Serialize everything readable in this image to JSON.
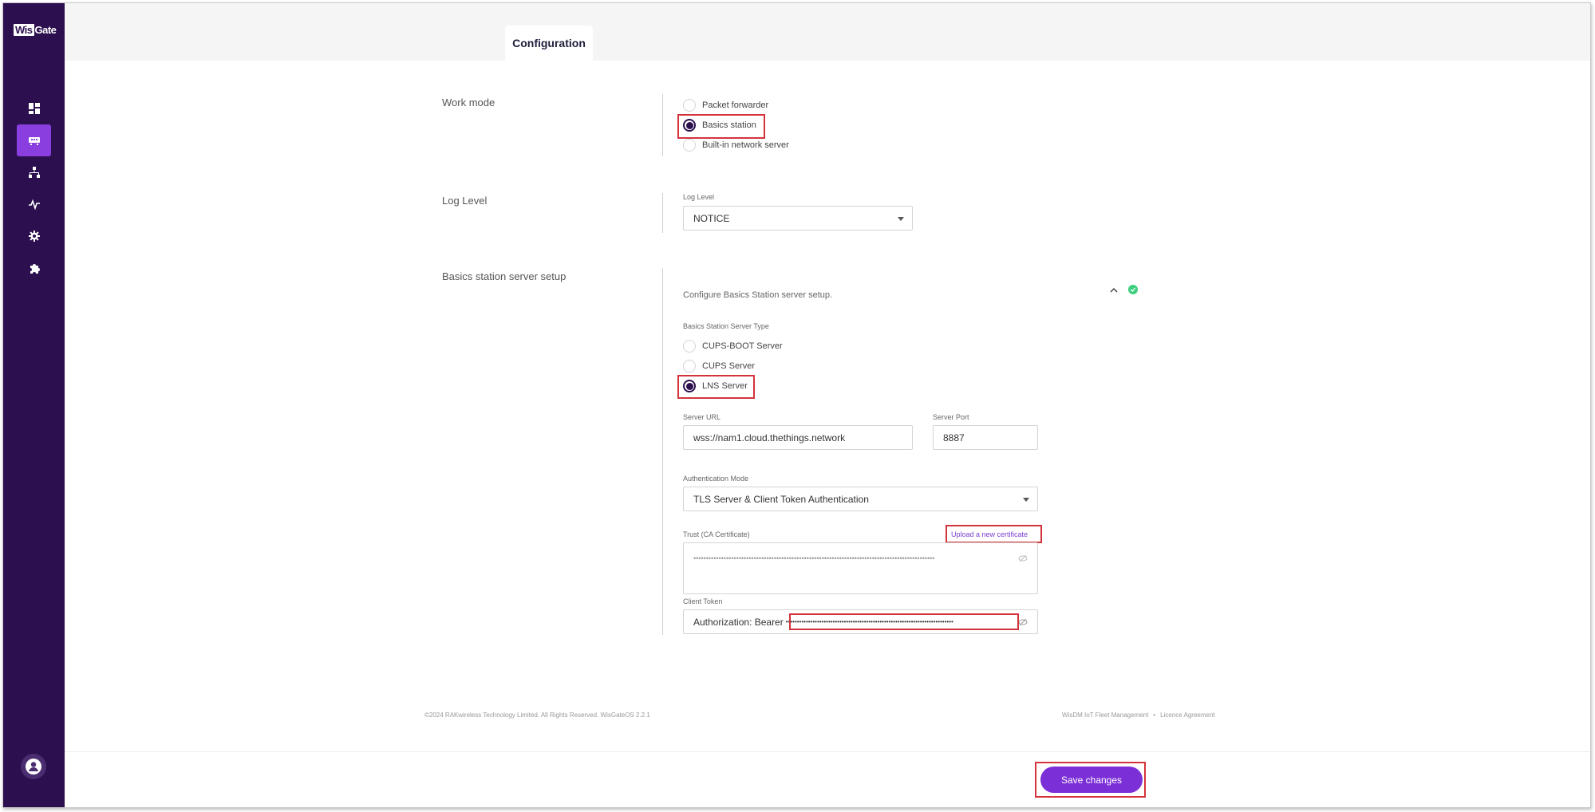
{
  "app": {
    "logo_prefix": "Wis",
    "logo_suffix": "Gate"
  },
  "sidebar": {
    "items": [
      {
        "name": "dashboard",
        "icon": "dashboard-icon"
      },
      {
        "name": "lora",
        "icon": "gateway-icon",
        "active": true
      },
      {
        "name": "network",
        "icon": "network-tree-icon"
      },
      {
        "name": "diagnostics",
        "icon": "activity-icon"
      },
      {
        "name": "settings",
        "icon": "gear-icon"
      },
      {
        "name": "extensions",
        "icon": "puzzle-icon"
      }
    ],
    "avatar_icon": "user-avatar-icon"
  },
  "tabs": [
    {
      "label": "Configuration",
      "active": true
    }
  ],
  "work_mode": {
    "label": "Work mode",
    "options": [
      "Packet forwarder",
      "Basics station",
      "Built-in network server"
    ],
    "selected": "Basics station"
  },
  "log_level": {
    "label": "Log Level",
    "field_label": "Log Level",
    "value": "NOTICE"
  },
  "basics_station": {
    "label": "Basics station server setup",
    "description": "Configure Basics Station server setup.",
    "server_type_label": "Basics Station Server Type",
    "server_types": [
      "CUPS-BOOT Server",
      "CUPS Server",
      "LNS Server"
    ],
    "selected_type": "LNS Server",
    "server_url_label": "Server URL",
    "server_url": "wss://nam1.cloud.thethings.network",
    "server_port_label": "Server Port",
    "server_port": "8887",
    "auth_mode_label": "Authentication Mode",
    "auth_mode": "TLS Server & Client Token Authentication",
    "trust_label": "Trust (CA Certificate)",
    "upload_link": "Upload a new certificate",
    "trust_masked": "••••••••••••••••••••••••••••••••••••••••••••••••••••••••••••••••••••••••••••••••••••••••••••••••",
    "client_token_label": "Client Token",
    "client_token_prefix": "Authorization: Bearer",
    "client_token_masked": "•••••••••••••••••••••••••••••••••••••••••••••••••••••••••••••••••••••••••••"
  },
  "footer": {
    "copyright": "©2024 RAKwireless Technology Limited. All Rights Reserved. WisGateOS 2.2.1",
    "link_fleet": "WisDM IoT Fleet Management",
    "link_licence": "Licence Agreement",
    "separator": "•"
  },
  "actions": {
    "save_label": "Save changes"
  },
  "colors": {
    "sidebar": "#2c0f4e",
    "accent": "#8a3ee0",
    "button": "#7b2fd6",
    "highlight": "#d3343b",
    "success": "#3ccf7d"
  }
}
